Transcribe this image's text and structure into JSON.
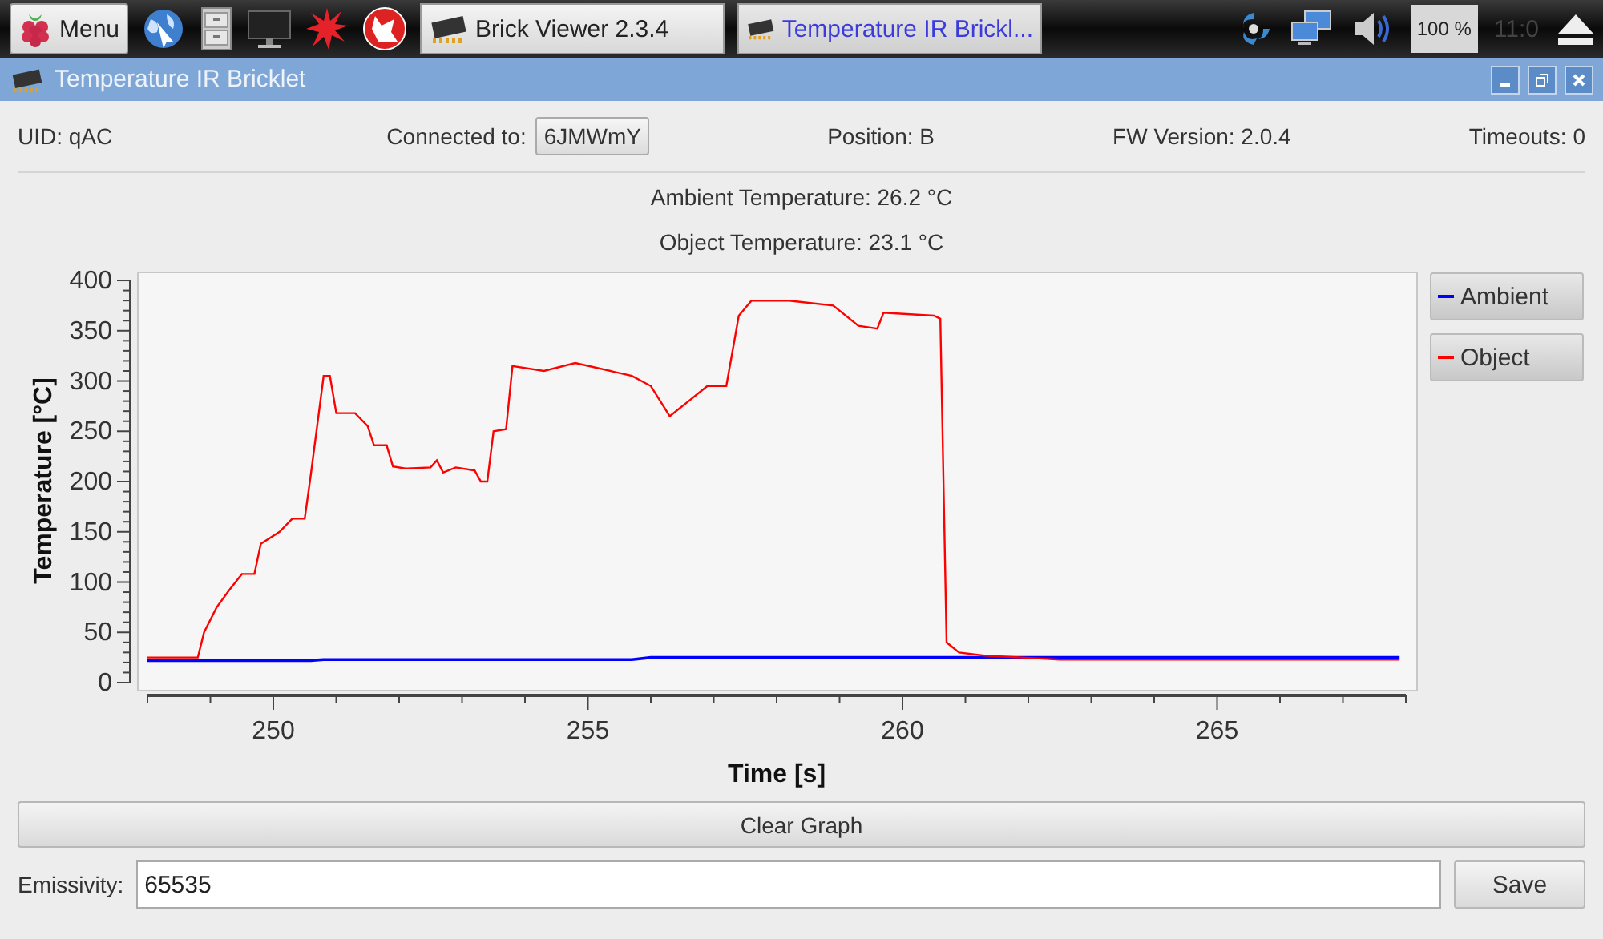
{
  "taskbar": {
    "menu_label": "Menu",
    "tasks": [
      {
        "label": "Brick Viewer 2.3.4",
        "selected": false
      },
      {
        "label": "Temperature IR Brickl...",
        "selected": true
      }
    ],
    "cpu": "100 %",
    "clock": "11:0"
  },
  "window": {
    "title": "Temperature IR Bricklet"
  },
  "info": {
    "uid": "UID: qAC",
    "connected_label": "Connected to:",
    "connected_value": "6JMWmY",
    "position": "Position: B",
    "fw": "FW Version: 2.0.4",
    "timeouts": "Timeouts: 0"
  },
  "readings": [
    "Ambient Temperature: 26.2 °C",
    "Object Temperature: 23.1 °C"
  ],
  "chart_data": {
    "type": "line",
    "legend": "right",
    "xlabel": "Time [s]",
    "ylabel": "Temperature [°C]",
    "xlim": [
      248,
      268
    ],
    "ylim": [
      0,
      408
    ],
    "xticks": [
      250,
      255,
      260,
      265
    ],
    "yticks": [
      0,
      50,
      100,
      150,
      200,
      250,
      300,
      350,
      400
    ],
    "x": [
      248.0,
      248.8,
      248.9,
      249.1,
      249.3,
      249.5,
      249.7,
      249.8,
      250.1,
      250.3,
      250.5,
      250.6,
      250.8,
      250.9,
      251.0,
      251.3,
      251.5,
      251.6,
      251.8,
      251.9,
      252.1,
      252.5,
      252.6,
      252.7,
      252.9,
      253.2,
      253.3,
      253.4,
      253.5,
      253.7,
      253.8,
      254.3,
      254.8,
      255.7,
      256.0,
      256.3,
      256.6,
      256.9,
      257.2,
      257.4,
      257.6,
      258.2,
      258.9,
      259.3,
      259.6,
      259.7,
      260.5,
      260.6,
      260.7,
      260.9,
      261.3,
      261.9,
      262.5,
      262.7,
      267.9
    ],
    "series": [
      {
        "name": "Ambient",
        "color": "#0000ff",
        "values": [
          22,
          22,
          22,
          22,
          22,
          22,
          22,
          22,
          22,
          22,
          22,
          22,
          23,
          23,
          23,
          23,
          23,
          23,
          23,
          23,
          23,
          23,
          23,
          23,
          23,
          23,
          23,
          23,
          23,
          23,
          23,
          23,
          23,
          23,
          25,
          25,
          25,
          25,
          25,
          25,
          25,
          25,
          25,
          25,
          25,
          25,
          25,
          25,
          25,
          25,
          25,
          25,
          25,
          25,
          25
        ]
      },
      {
        "name": "Object",
        "color": "#ff0000",
        "values": [
          25,
          25,
          50,
          75,
          92,
          108,
          108,
          138,
          150,
          163,
          163,
          208,
          305,
          305,
          268,
          268,
          255,
          236,
          236,
          215,
          213,
          214,
          221,
          209,
          214,
          211,
          200,
          200,
          250,
          252,
          315,
          310,
          318,
          305,
          295,
          265,
          280,
          295,
          295,
          365,
          380,
          380,
          375,
          355,
          352,
          368,
          365,
          362,
          40,
          30,
          27,
          25,
          23,
          23,
          23
        ]
      }
    ]
  },
  "clear_button": "Clear Graph",
  "emissivity": {
    "label": "Emissivity:",
    "value": "65535",
    "save": "Save"
  }
}
